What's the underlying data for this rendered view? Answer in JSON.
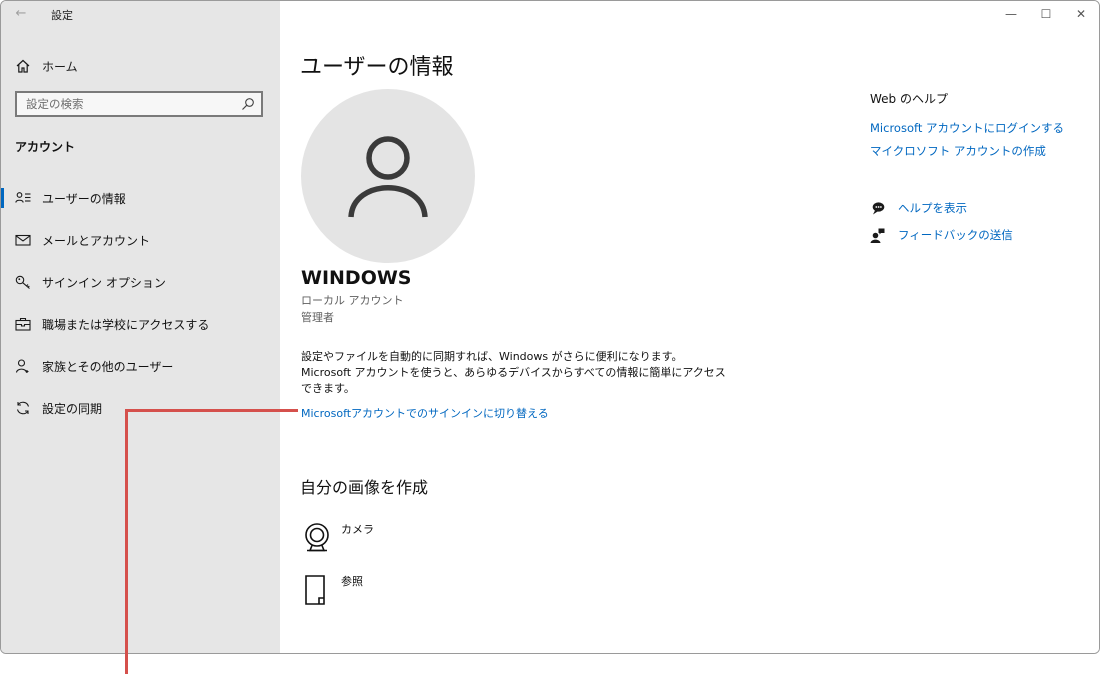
{
  "window": {
    "title": "設定",
    "back_glyph": "←",
    "minimize_glyph": "—",
    "maximize_glyph": "☐",
    "close_glyph": "✕"
  },
  "sidebar": {
    "home_label": "ホーム",
    "search_placeholder": "設定の検索",
    "section_label": "アカウント",
    "items": [
      {
        "label": "ユーザーの情報",
        "icon": "user-info-icon",
        "active": true
      },
      {
        "label": "メールとアカウント",
        "icon": "mail-icon",
        "active": false
      },
      {
        "label": "サインイン オプション",
        "icon": "key-icon",
        "active": false
      },
      {
        "label": "職場または学校にアクセスする",
        "icon": "briefcase-icon",
        "active": false
      },
      {
        "label": "家族とその他のユーザー",
        "icon": "person-add-icon",
        "active": false
      },
      {
        "label": "設定の同期",
        "icon": "sync-icon",
        "active": false
      }
    ]
  },
  "main": {
    "title": "ユーザーの情報",
    "user": {
      "name": "WINDOWS",
      "account_type": "ローカル アカウント",
      "role": "管理者"
    },
    "description": [
      "設定やファイルを自動的に同期すれば、Windows がさらに便利になります。",
      "Microsoft アカウントを使うと、あらゆるデバイスからすべての情報に簡単にアクセス",
      "できます。"
    ],
    "ms_signin_link": "Microsoftアカウントでのサインインに切り替える",
    "create_picture": {
      "title": "自分の画像を作成",
      "camera_label": "カメラ",
      "browse_label": "参照"
    }
  },
  "help": {
    "title": "Web のヘルプ",
    "links": [
      "Microsoft アカウントにログインする",
      "マイクロソフト アカウントの作成"
    ],
    "get_help_label": "ヘルプを表示",
    "feedback_label": "フィードバックの送信"
  },
  "colors": {
    "accent": "#0067c0",
    "sidebar_bg": "#e6e6e6",
    "callout": "#d5504c"
  }
}
